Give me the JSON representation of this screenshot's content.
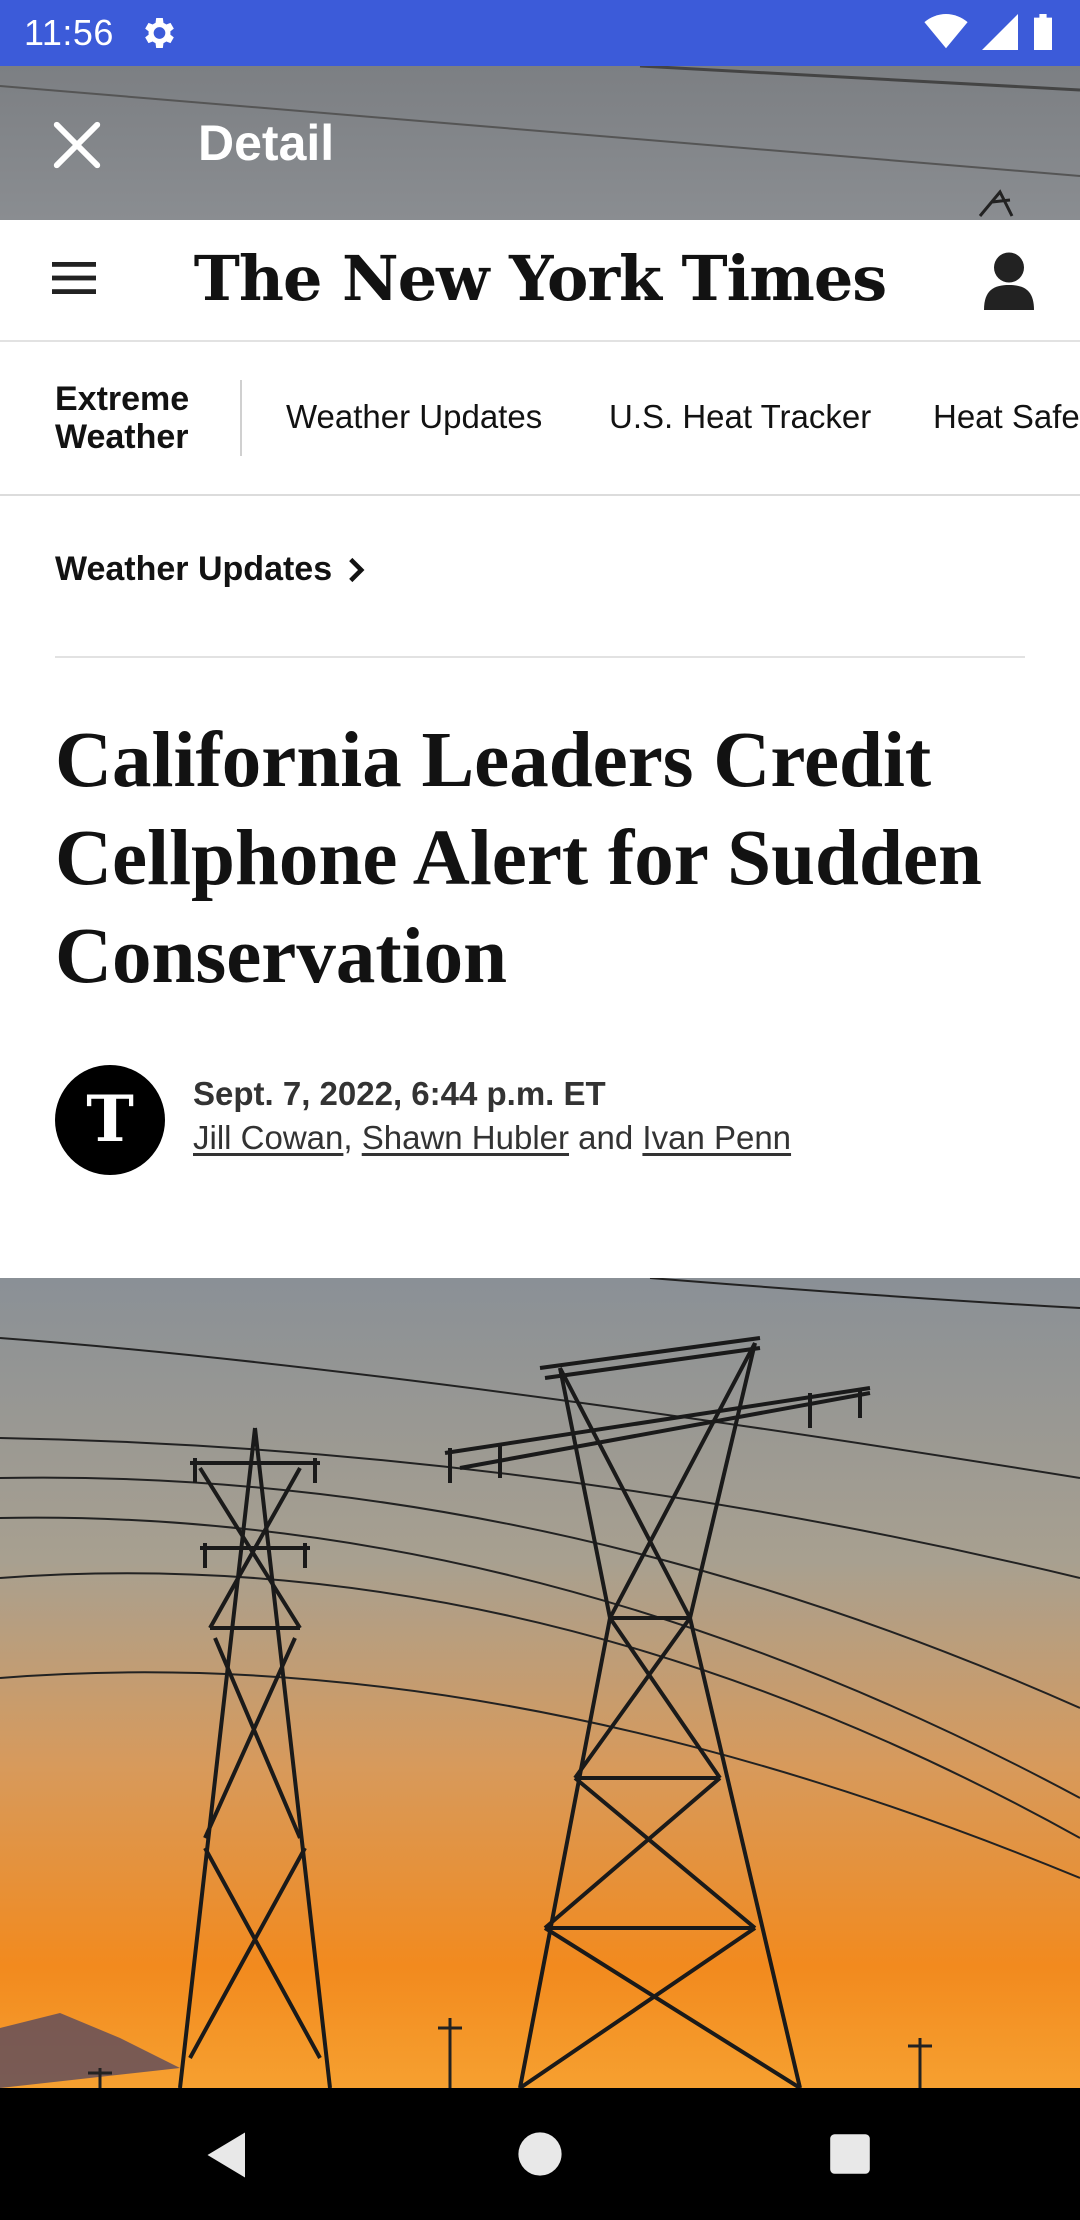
{
  "status_bar": {
    "time": "11:56",
    "icons": [
      "gear-icon",
      "wifi-icon",
      "signal-icon",
      "battery-icon"
    ]
  },
  "detail": {
    "title": "Detail"
  },
  "nyt": {
    "logo_text": "The New York Times"
  },
  "section_nav": {
    "label": "Extreme Weather",
    "items": [
      {
        "label": "Weather Updates"
      },
      {
        "label": "U.S. Heat Tracker"
      },
      {
        "label": "Heat Safe"
      }
    ]
  },
  "article": {
    "kicker": "Weather Updates",
    "headline": "California Leaders Credit Cellphone Alert for Sudden Conservation",
    "byline": {
      "logo_glyph": "T",
      "date": "Sept. 7, 2022, 6:44 p.m. ET",
      "authors": [
        "Jill Cowan",
        "Shawn Hubler",
        "Ivan Penn"
      ],
      "separator": ", ",
      "conjunction": " and "
    }
  },
  "colors": {
    "status_bar": "#3c5bd9",
    "text": "#121212",
    "sky_top": "#8a9096",
    "sky_bottom": "#f28a1e"
  }
}
